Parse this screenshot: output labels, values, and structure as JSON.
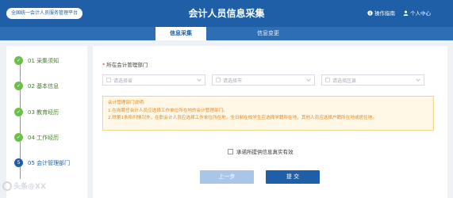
{
  "header": {
    "platform_button": "全国统一会计人员服务管理平台",
    "title": "会计人员信息采集",
    "links": [
      {
        "label": "操作指南",
        "icon": "info-icon"
      },
      {
        "label": "个人中心",
        "icon": "user-icon"
      }
    ]
  },
  "tabs": [
    {
      "label": "信息采集",
      "active": true
    },
    {
      "label": "信息变更",
      "active": false
    }
  ],
  "steps": [
    {
      "number": "✓",
      "label": "01 采集须知",
      "done": true
    },
    {
      "number": "✓",
      "label": "02 基本信息",
      "done": true
    },
    {
      "number": "✓",
      "label": "03 教育经历",
      "done": true
    },
    {
      "number": "✓",
      "label": "04 工作经历",
      "done": true
    },
    {
      "number": "5",
      "label": "05 会计管理部门",
      "done": false
    }
  ],
  "form": {
    "field_label": "所在会计管理部门",
    "selects": [
      {
        "placeholder": "请选择省"
      },
      {
        "placeholder": "请选择市"
      },
      {
        "placeholder": "请选择区县"
      }
    ],
    "notice": {
      "title": "会计管理部门说明:",
      "lines": [
        "1.在岗聘任会计人员应选择工作单位所在地的会计管理部门。",
        "2.除第1条所列情况外，在职会计人员应选择工作单位所在地，全日制在校学生应选择学籍所在地，其他人员应选择户籍所在地或居住地。"
      ]
    },
    "commitment": "承诺所提供信息真实有效",
    "buttons": {
      "prev": "上一步",
      "submit": "提 交"
    }
  },
  "watermark": "头条@XX"
}
